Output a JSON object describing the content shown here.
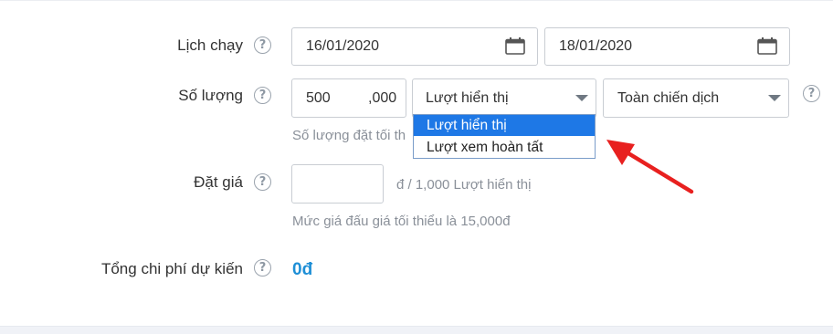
{
  "schedule": {
    "label": "Lịch chạy",
    "start_date": "16/01/2020",
    "end_date": "18/01/2020"
  },
  "quantity": {
    "label": "Số lượng",
    "value": "500",
    "suffix": ",000",
    "metric_selected": "Lượt hiển thị",
    "scope_selected": "Toàn chiến dịch",
    "hint": "Số lượng đặt tối th"
  },
  "metric_dropdown": {
    "options": [
      "Lượt hiển thị",
      "Lượt xem hoàn tất"
    ],
    "highlighted_index": 0
  },
  "bid": {
    "label": "Đặt giá",
    "value": "",
    "unit": "đ / 1,000 Lượt hiển thị",
    "hint": "Mức giá đấu giá tối thiểu là 15,000đ"
  },
  "total_cost": {
    "label": "Tổng chi phí dự kiến",
    "value": "0đ"
  },
  "help_glyph": "?",
  "colors": {
    "accent": "#1e8fd6",
    "highlight": "#1e78e6",
    "annotation_arrow": "#e8201f"
  }
}
